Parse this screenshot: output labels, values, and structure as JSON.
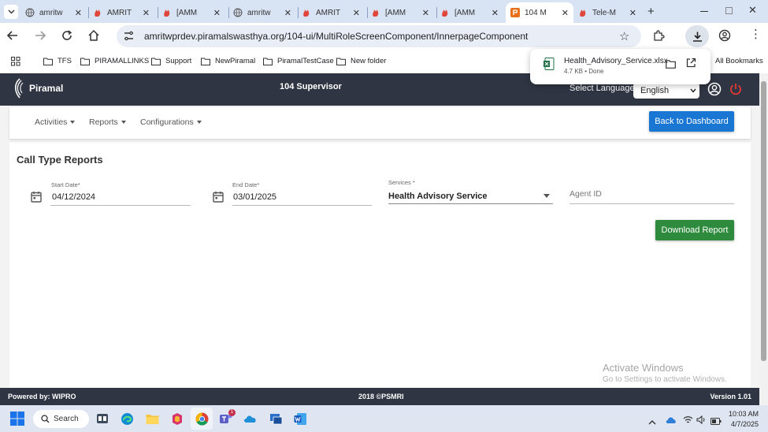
{
  "browser": {
    "tabs": [
      {
        "label": "amritw",
        "icon": "globe-icon"
      },
      {
        "label": "AMRIT",
        "icon": "amrit-flame-icon"
      },
      {
        "label": "[AMM",
        "icon": "amrit-flame-icon"
      },
      {
        "label": "amritw",
        "icon": "globe-icon"
      },
      {
        "label": "AMRIT",
        "icon": "amrit-flame-icon"
      },
      {
        "label": "[AMM",
        "icon": "amrit-flame-icon"
      },
      {
        "label": "[AMM",
        "icon": "amrit-flame-icon"
      },
      {
        "label": "104 M",
        "icon": "piramal-icon",
        "active": true
      },
      {
        "label": "Tele-M",
        "icon": "amrit-flame-icon"
      }
    ],
    "url": "amritwprdev.piramalswasthya.org/104-ui/MultiRoleScreenComponent/InnerpageComponent",
    "bookmarks": [
      "TFS",
      "PIRAMALLINKS",
      "Support",
      "NewPiramal",
      "PiramalTestCase",
      "New folder"
    ],
    "all_bookmarks": "All Bookmarks",
    "download": {
      "file": "Health_Advisory_Service.xlsx",
      "status": "4.7 KB • Done"
    }
  },
  "app": {
    "brand": "Piramal",
    "title": "104 Supervisor",
    "language_label": "Select Language:",
    "language_value": "English",
    "nav": [
      "Activities",
      "Reports",
      "Configurations"
    ],
    "back_button": "Back to Dashboard",
    "page_title": "Call Type Reports",
    "form": {
      "start_date_label": "Start Date*",
      "start_date_value": "04/12/2024",
      "end_date_label": "End Date*",
      "end_date_value": "03/01/2025",
      "services_label": "Services *",
      "services_value": "Health Advisory Service",
      "agent_placeholder": "Agent ID"
    },
    "download_button": "Download Report",
    "watermark_title": "Activate Windows",
    "watermark_sub": "Go to Settings to activate Windows.",
    "footer": {
      "left": "Powered by: WIPRO",
      "center": "2018 ©PSMRI",
      "right": "Version 1.01"
    }
  },
  "taskbar": {
    "search": "Search",
    "time": "10:03 AM",
    "date": "4/7/2025",
    "teams_badge": "1"
  },
  "colors": {
    "header_bg": "#2f3542",
    "primary_blue": "#1976d2",
    "download_green": "#2e8b3d",
    "tabstrip_bg": "#d8e3f4"
  }
}
